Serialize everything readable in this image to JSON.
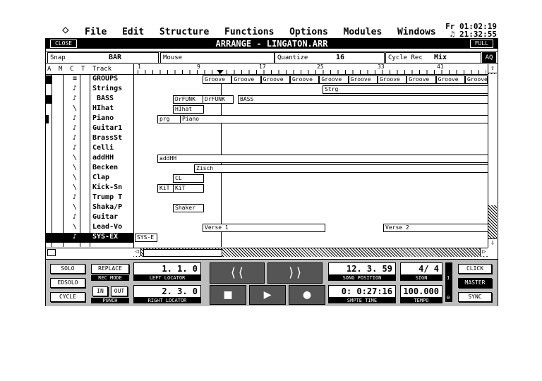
{
  "menubar": {
    "apple_icon": "diamond-icon",
    "items": [
      "File",
      "Edit",
      "Structure",
      "Functions",
      "Options",
      "Modules",
      "Windows"
    ]
  },
  "clock": {
    "line1": "Fr 01:02:19",
    "line2": "21:32:55"
  },
  "window": {
    "close_label": "CLOSE",
    "title": "ARRANGE - LINGATON.ARR",
    "full_label": "FULL"
  },
  "infobar": {
    "snap_label": "Snap",
    "snap_value": "BAR",
    "mouse_label": "Mouse",
    "quantize_label": "Quantize",
    "quantize_value": "16",
    "cycle_rec_label": "Cycle Rec",
    "cycle_rec_value": "Mix",
    "aq_label": "AQ"
  },
  "columns": {
    "a": "A",
    "m": "M",
    "c": "C",
    "t": "T",
    "track": "Track"
  },
  "ruler": {
    "labels": [
      "1",
      "9",
      "17",
      "25",
      "33",
      "41"
    ]
  },
  "tracks": [
    {
      "name": "GROUPS",
      "icon": "≡"
    },
    {
      "name": "Strings",
      "icon": "♪"
    },
    {
      "name": "BASS",
      "icon": "♪"
    },
    {
      "name": "HIhat",
      "icon": "\\"
    },
    {
      "name": "Piano",
      "icon": "♪"
    },
    {
      "name": "Guitar1",
      "icon": "♪"
    },
    {
      "name": "BrassSt",
      "icon": "♪"
    },
    {
      "name": "Celli",
      "icon": "♪"
    },
    {
      "name": "addHH",
      "icon": "\\"
    },
    {
      "name": "Becken",
      "icon": "\\"
    },
    {
      "name": "Clap",
      "icon": "\\"
    },
    {
      "name": "Kick-Sn",
      "icon": "\\"
    },
    {
      "name": "Trump T",
      "icon": "♪"
    },
    {
      "name": "Shaka/P",
      "icon": "\\"
    },
    {
      "name": "Guitar",
      "icon": "♪"
    },
    {
      "name": "Lead-Vo",
      "icon": "\\"
    },
    {
      "name": "SYS-EX",
      "icon": "♪"
    }
  ],
  "parts": {
    "groove": "Groove",
    "strings": "Strg",
    "drfunk1": "DrFUNK",
    "drfunk2": "DrFUNK",
    "bass": "BASS",
    "hihat": "HIhat",
    "prg": "prg",
    "piano": "Piano",
    "addhh": "addHH",
    "zisch": "Zisch",
    "cl": "CL",
    "kit1": "KiT",
    "kit2": "KiT",
    "shaker": "Shaker",
    "verse1": "Verse 1",
    "verse2": "Verse 2",
    "sysex": "SYS-E"
  },
  "transport": {
    "solo": "SOLO",
    "edsolo": "EDSOLO",
    "cycle": "CYCLE",
    "replace": "REPLACE",
    "rec_mode": "REC MODE",
    "in": "IN",
    "out": "OUT",
    "punch": "PUNCH",
    "left_locator_value": "1. 1. 0",
    "left_locator_label": "LEFT LOCATOR",
    "right_locator_value": "2. 3. 0",
    "right_locator_label": "RIGHT LOCATOR",
    "rewind_icon": "rewind-icon",
    "ffwd_icon": "fast-forward-icon",
    "stop_icon": "stop-icon",
    "play_icon": "play-icon",
    "record_icon": "record-icon",
    "song_position_value": "12. 3. 59",
    "song_position_label": "SONG POSITION",
    "smpte_value": "0: 0:27:16",
    "smpte_label": "SMPTE TIME",
    "sign_value": "4/ 4",
    "sign_label": "SIGN",
    "tempo_value": "100.000",
    "tempo_label": "TEMPO",
    "click": "CLICK",
    "master": "MASTER",
    "sync": "SYNC",
    "meter_1": "1",
    "meter_0": "0"
  }
}
